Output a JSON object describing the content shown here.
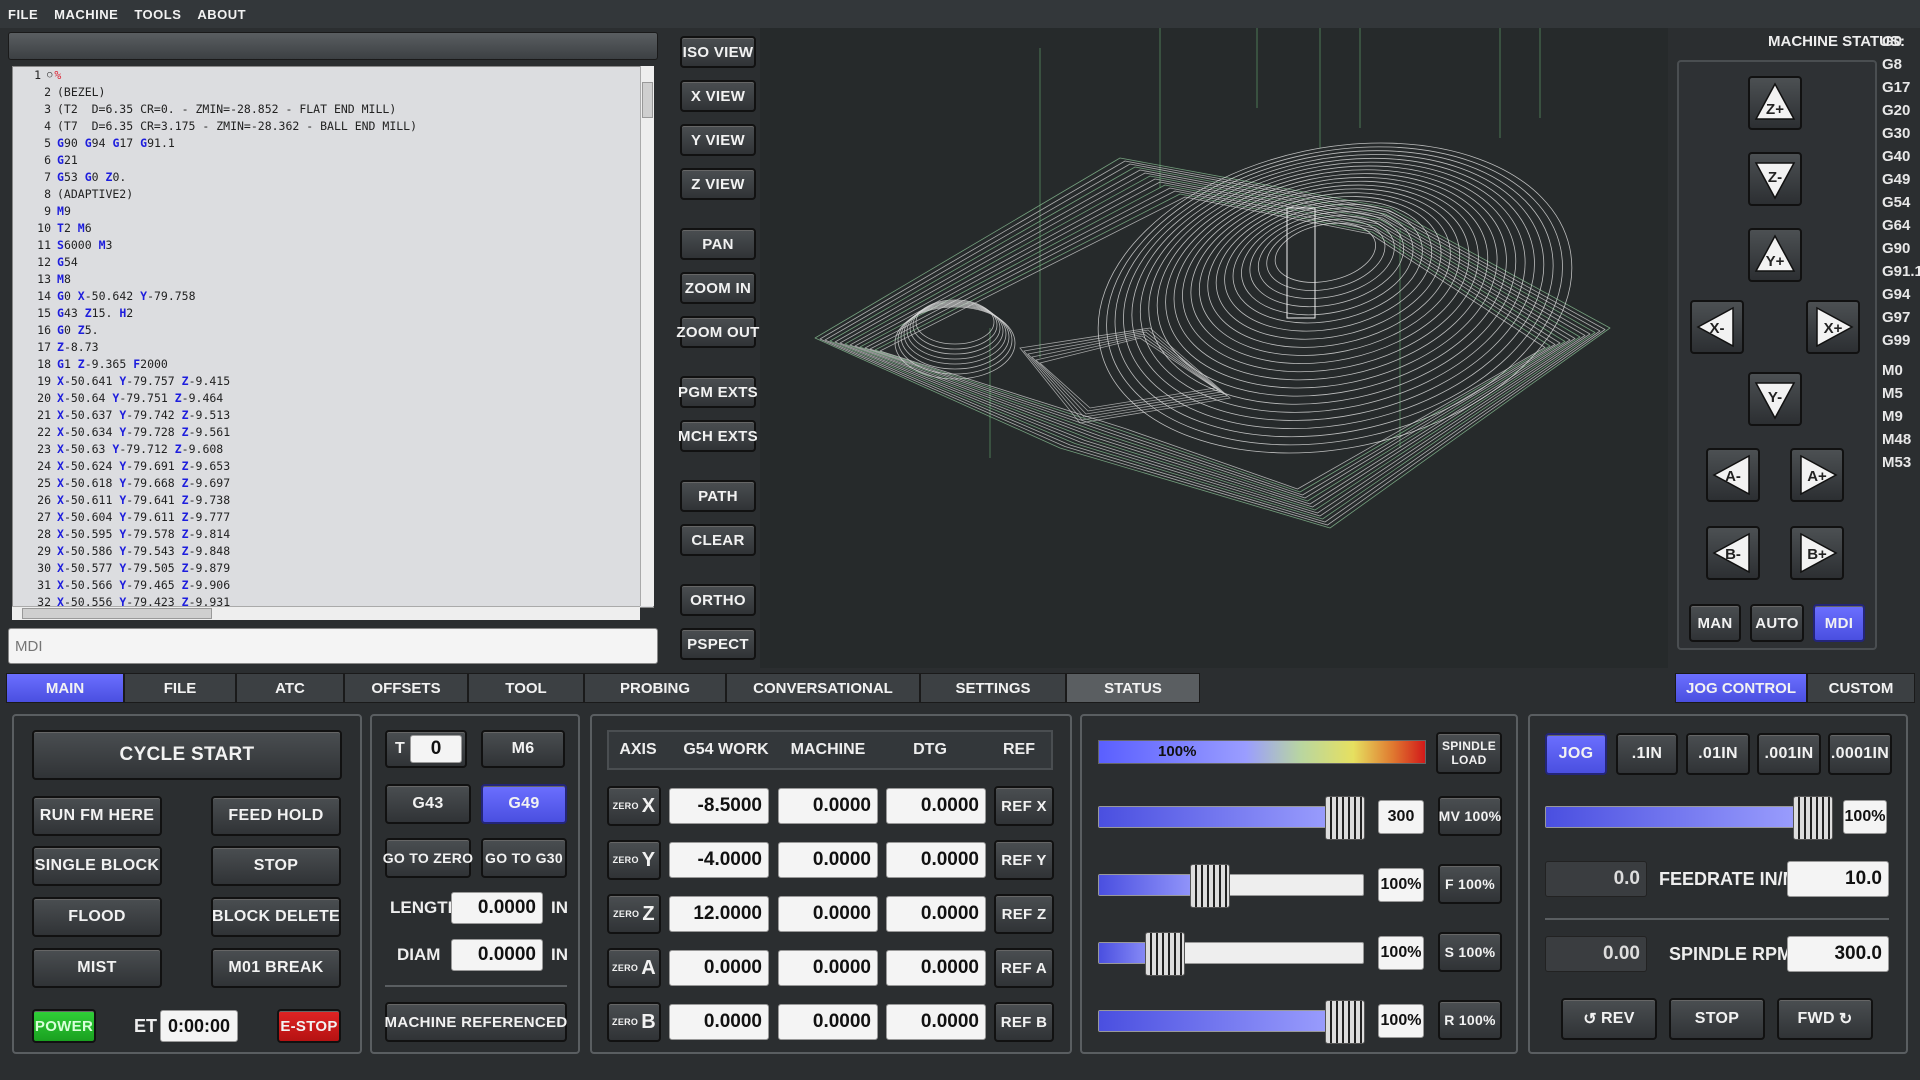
{
  "menu": [
    "FILE",
    "MACHINE",
    "TOOLS",
    "ABOUT"
  ],
  "gcode_lines": [
    [
      "1",
      [
        [
          "t",
          "%"
        ]
      ]
    ],
    [
      "2",
      [
        [
          "t",
          "(BEZEL)"
        ]
      ]
    ],
    [
      "3",
      [
        [
          "t",
          "(T2  D=6.35 CR=0. - ZMIN=-28.852 - FLAT END MILL)"
        ]
      ]
    ],
    [
      "4",
      [
        [
          "t",
          "(T7  D=6.35 CR=3.175 - ZMIN=-28.362 - BALL END MILL)"
        ]
      ]
    ],
    [
      "5",
      [
        [
          "w",
          "G"
        ],
        [
          "t",
          "90 "
        ],
        [
          "w",
          "G"
        ],
        [
          "t",
          "94 "
        ],
        [
          "w",
          "G"
        ],
        [
          "t",
          "17 "
        ],
        [
          "w",
          "G"
        ],
        [
          "t",
          "91.1"
        ]
      ]
    ],
    [
      "6",
      [
        [
          "w",
          "G"
        ],
        [
          "t",
          "21"
        ]
      ]
    ],
    [
      "7",
      [
        [
          "w",
          "G"
        ],
        [
          "t",
          "53 "
        ],
        [
          "w",
          "G"
        ],
        [
          "t",
          "0 "
        ],
        [
          "w",
          "Z"
        ],
        [
          "t",
          "0."
        ]
      ]
    ],
    [
      "8",
      [
        [
          "t",
          "(ADAPTIVE2)"
        ]
      ]
    ],
    [
      "9",
      [
        [
          "w",
          "M"
        ],
        [
          "t",
          "9"
        ]
      ]
    ],
    [
      "10",
      [
        [
          "w",
          "T"
        ],
        [
          "t",
          "2 "
        ],
        [
          "w",
          "M"
        ],
        [
          "t",
          "6"
        ]
      ]
    ],
    [
      "11",
      [
        [
          "w",
          "S"
        ],
        [
          "t",
          "6000 "
        ],
        [
          "w",
          "M"
        ],
        [
          "t",
          "3"
        ]
      ]
    ],
    [
      "12",
      [
        [
          "w",
          "G"
        ],
        [
          "t",
          "54"
        ]
      ]
    ],
    [
      "13",
      [
        [
          "w",
          "M"
        ],
        [
          "t",
          "8"
        ]
      ]
    ],
    [
      "14",
      [
        [
          "w",
          "G"
        ],
        [
          "t",
          "0 "
        ],
        [
          "w",
          "X"
        ],
        [
          "t",
          "-50.642 "
        ],
        [
          "w",
          "Y"
        ],
        [
          "t",
          "-79.758"
        ]
      ]
    ],
    [
      "15",
      [
        [
          "w",
          "G"
        ],
        [
          "t",
          "43 "
        ],
        [
          "w",
          "Z"
        ],
        [
          "t",
          "15. "
        ],
        [
          "w",
          "H"
        ],
        [
          "t",
          "2"
        ]
      ]
    ],
    [
      "16",
      [
        [
          "w",
          "G"
        ],
        [
          "t",
          "0 "
        ],
        [
          "w",
          "Z"
        ],
        [
          "t",
          "5."
        ]
      ]
    ],
    [
      "17",
      [
        [
          "w",
          "Z"
        ],
        [
          "t",
          "-8.73"
        ]
      ]
    ],
    [
      "18",
      [
        [
          "w",
          "G"
        ],
        [
          "t",
          "1 "
        ],
        [
          "w",
          "Z"
        ],
        [
          "t",
          "-9.365 "
        ],
        [
          "w",
          "F"
        ],
        [
          "t",
          "2000"
        ]
      ]
    ],
    [
      "19",
      [
        [
          "w",
          "X"
        ],
        [
          "t",
          "-50.641 "
        ],
        [
          "w",
          "Y"
        ],
        [
          "t",
          "-79.757 "
        ],
        [
          "w",
          "Z"
        ],
        [
          "t",
          "-9.415"
        ]
      ]
    ],
    [
      "20",
      [
        [
          "w",
          "X"
        ],
        [
          "t",
          "-50.64 "
        ],
        [
          "w",
          "Y"
        ],
        [
          "t",
          "-79.751 "
        ],
        [
          "w",
          "Z"
        ],
        [
          "t",
          "-9.464"
        ]
      ]
    ],
    [
      "21",
      [
        [
          "w",
          "X"
        ],
        [
          "t",
          "-50.637 "
        ],
        [
          "w",
          "Y"
        ],
        [
          "t",
          "-79.742 "
        ],
        [
          "w",
          "Z"
        ],
        [
          "t",
          "-9.513"
        ]
      ]
    ],
    [
      "22",
      [
        [
          "w",
          "X"
        ],
        [
          "t",
          "-50.634 "
        ],
        [
          "w",
          "Y"
        ],
        [
          "t",
          "-79.728 "
        ],
        [
          "w",
          "Z"
        ],
        [
          "t",
          "-9.561"
        ]
      ]
    ],
    [
      "23",
      [
        [
          "w",
          "X"
        ],
        [
          "t",
          "-50.63 "
        ],
        [
          "w",
          "Y"
        ],
        [
          "t",
          "-79.712 "
        ],
        [
          "w",
          "Z"
        ],
        [
          "t",
          "-9.608"
        ]
      ]
    ],
    [
      "24",
      [
        [
          "w",
          "X"
        ],
        [
          "t",
          "-50.624 "
        ],
        [
          "w",
          "Y"
        ],
        [
          "t",
          "-79.691 "
        ],
        [
          "w",
          "Z"
        ],
        [
          "t",
          "-9.653"
        ]
      ]
    ],
    [
      "25",
      [
        [
          "w",
          "X"
        ],
        [
          "t",
          "-50.618 "
        ],
        [
          "w",
          "Y"
        ],
        [
          "t",
          "-79.668 "
        ],
        [
          "w",
          "Z"
        ],
        [
          "t",
          "-9.697"
        ]
      ]
    ],
    [
      "26",
      [
        [
          "w",
          "X"
        ],
        [
          "t",
          "-50.611 "
        ],
        [
          "w",
          "Y"
        ],
        [
          "t",
          "-79.641 "
        ],
        [
          "w",
          "Z"
        ],
        [
          "t",
          "-9.738"
        ]
      ]
    ],
    [
      "27",
      [
        [
          "w",
          "X"
        ],
        [
          "t",
          "-50.604 "
        ],
        [
          "w",
          "Y"
        ],
        [
          "t",
          "-79.611 "
        ],
        [
          "w",
          "Z"
        ],
        [
          "t",
          "-9.777"
        ]
      ]
    ],
    [
      "28",
      [
        [
          "w",
          "X"
        ],
        [
          "t",
          "-50.595 "
        ],
        [
          "w",
          "Y"
        ],
        [
          "t",
          "-79.578 "
        ],
        [
          "w",
          "Z"
        ],
        [
          "t",
          "-9.814"
        ]
      ]
    ],
    [
      "29",
      [
        [
          "w",
          "X"
        ],
        [
          "t",
          "-50.586 "
        ],
        [
          "w",
          "Y"
        ],
        [
          "t",
          "-79.543 "
        ],
        [
          "w",
          "Z"
        ],
        [
          "t",
          "-9.848"
        ]
      ]
    ],
    [
      "30",
      [
        [
          "w",
          "X"
        ],
        [
          "t",
          "-50.577 "
        ],
        [
          "w",
          "Y"
        ],
        [
          "t",
          "-79.505 "
        ],
        [
          "w",
          "Z"
        ],
        [
          "t",
          "-9.879"
        ]
      ]
    ],
    [
      "31",
      [
        [
          "w",
          "X"
        ],
        [
          "t",
          "-50.566 "
        ],
        [
          "w",
          "Y"
        ],
        [
          "t",
          "-79.465 "
        ],
        [
          "w",
          "Z"
        ],
        [
          "t",
          "-9.906"
        ]
      ]
    ],
    [
      "32",
      [
        [
          "w",
          "X"
        ],
        [
          "t",
          "-50.556 "
        ],
        [
          "w",
          "Y"
        ],
        [
          "t",
          "-79.423 "
        ],
        [
          "w",
          "Z"
        ],
        [
          "t",
          "-9.931"
        ]
      ]
    ]
  ],
  "mdi_placeholder": "MDI",
  "view_buttons": [
    "ISO VIEW",
    "X VIEW",
    "Y VIEW",
    "Z VIEW",
    "PAN",
    "ZOOM IN",
    "ZOOM OUT",
    "PGM EXTS",
    "MCH EXTS",
    "PATH",
    "CLEAR",
    "ORTHO",
    "PSPECT"
  ],
  "machine_status_label": "MACHINE STATUS:",
  "active_gcodes": [
    "G0",
    "G8",
    "G17",
    "G20",
    "G30",
    "G40",
    "G49",
    "G54",
    "G64",
    "G90",
    "G91.1",
    "G94",
    "G97",
    "G99"
  ],
  "active_mcodes": [
    "M0",
    "M5",
    "M9",
    "M48",
    "M53"
  ],
  "jog": {
    "zplus": "Z+",
    "zminus": "Z-",
    "yplus": "Y+",
    "yminus": "Y-",
    "xminus": "X-",
    "xplus": "X+",
    "aminus": "A-",
    "aplus": "A+",
    "bminus": "B-",
    "bplus": "B+"
  },
  "mode_buttons": {
    "man": "MAN",
    "auto": "AUTO",
    "mdi": "MDI"
  },
  "tabs": [
    "MAIN",
    "FILE",
    "ATC",
    "OFFSETS",
    "TOOL",
    "PROBING",
    "CONVERSATIONAL",
    "SETTINGS",
    "STATUS"
  ],
  "right_tabs": [
    "JOG CONTROL",
    "CUSTOM"
  ],
  "control": {
    "cycle_start": "CYCLE START",
    "run_from_here": "RUN FM HERE",
    "feed_hold": "FEED HOLD",
    "single_block": "SINGLE BLOCK",
    "stop": "STOP",
    "flood": "FLOOD",
    "block_delete": "BLOCK DELETE",
    "mist": "MIST",
    "m01_break": "M01 BREAK",
    "power": "POWER",
    "et_label": "ET",
    "et_value": "0:00:00",
    "estop": "E-STOP"
  },
  "tool": {
    "t_label": "T",
    "t_value": "0",
    "m6": "M6",
    "g43": "G43",
    "g49": "G49",
    "go_to_zero": "GO TO ZERO",
    "go_to_g30": "GO TO G30",
    "length_label": "LENGTH",
    "length_value": "0.0000",
    "length_unit": "IN",
    "diam_label": "DIAM",
    "diam_value": "0.0000",
    "diam_unit": "IN",
    "machine_referenced": "MACHINE REFERENCED"
  },
  "dro": {
    "headers": [
      "AXIS",
      "G54 WORK",
      "MACHINE",
      "DTG",
      "REF"
    ],
    "zero_label": "ZERO",
    "rows": [
      {
        "axis": "X",
        "work": "-8.5000",
        "machine": "0.0000",
        "dtg": "0.0000",
        "ref": "REF X"
      },
      {
        "axis": "Y",
        "work": "-4.0000",
        "machine": "0.0000",
        "dtg": "0.0000",
        "ref": "REF Y"
      },
      {
        "axis": "Z",
        "work": "12.0000",
        "machine": "0.0000",
        "dtg": "0.0000",
        "ref": "REF Z"
      },
      {
        "axis": "A",
        "work": "0.0000",
        "machine": "0.0000",
        "dtg": "0.0000",
        "ref": "REF A"
      },
      {
        "axis": "B",
        "work": "0.0000",
        "machine": "0.0000",
        "dtg": "0.0000",
        "ref": "REF B"
      }
    ]
  },
  "overrides": {
    "spindle_load_value": "100%",
    "spindle_load_fraction": 1.0,
    "spindle_load_label": "SPINDLE LOAD",
    "rows": [
      {
        "value": "300",
        "button": "MV 100%",
        "fraction": 0.93
      },
      {
        "value": "100%",
        "button": "F 100%",
        "fraction": 0.42
      },
      {
        "value": "100%",
        "button": "S 100%",
        "fraction": 0.25
      },
      {
        "value": "100%",
        "button": "R 100%",
        "fraction": 0.93
      }
    ]
  },
  "jogpanel": {
    "jog": "JOG",
    "inc1": ".1IN",
    "inc2": ".01IN",
    "inc3": ".001IN",
    "inc4": ".0001IN",
    "jog_rate_value": "100%",
    "jog_rate_fraction": 0.96,
    "feed_actual": "0.0",
    "feed_label": "FEEDRATE IN/M",
    "feed_value": "10.0",
    "spindle_actual": "0.00",
    "spindle_label": "SPINDLE RPM",
    "spindle_value": "300.0",
    "rev": "REV",
    "stop": "STOP",
    "fwd": "FWD"
  },
  "colors": {
    "accent": "#5a5fff",
    "estop": "#d21a1a",
    "power": "#22c02a",
    "panel_bg": "#2b2e30"
  }
}
